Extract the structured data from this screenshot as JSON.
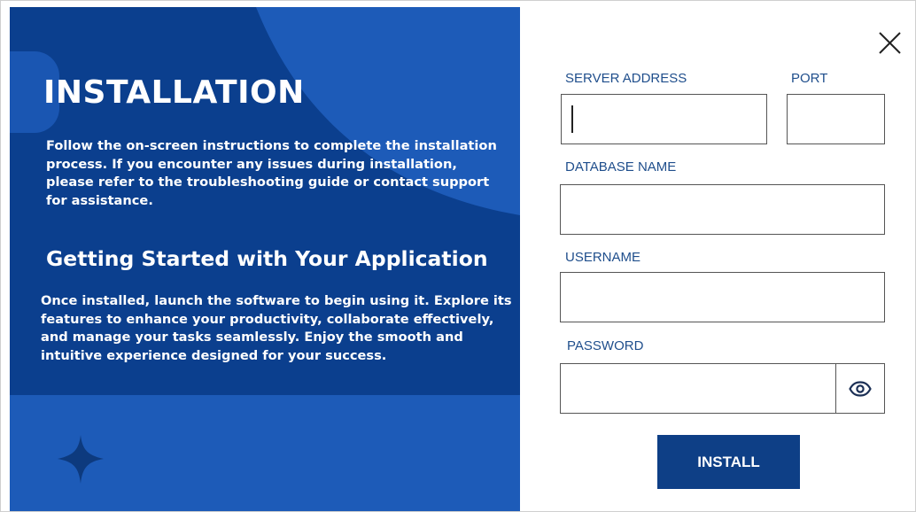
{
  "colors": {
    "panel_blue": "#1d5bb8",
    "panel_dark": "#0b3f8e",
    "label_blue": "#1f4e8c",
    "button_blue": "#0e3f86"
  },
  "left": {
    "title": "INSTALLATION",
    "intro": "Follow the on-screen instructions to complete the installation process. If you encounter any issues during installation, please refer to the troubleshooting guide or contact support for assistance.",
    "subtitle": "Getting Started with Your Application",
    "body": "Once installed, launch the software to begin using it. Explore its features to enhance your productivity, collaborate effectively, and manage your tasks seamlessly. Enjoy the smooth and intuitive experience designed for your success.",
    "decor_icon": "sparkle-star-icon"
  },
  "form": {
    "close_icon": "close-icon",
    "server_address": {
      "label": "SERVER ADDRESS",
      "value": ""
    },
    "port": {
      "label": "PORT",
      "value": ""
    },
    "database_name": {
      "label": "DATABASE NAME",
      "value": ""
    },
    "username": {
      "label": "USERNAME",
      "value": ""
    },
    "password": {
      "label": "PASSWORD",
      "value": "",
      "toggle_icon": "eye-icon"
    },
    "install_label": "INSTALL"
  }
}
